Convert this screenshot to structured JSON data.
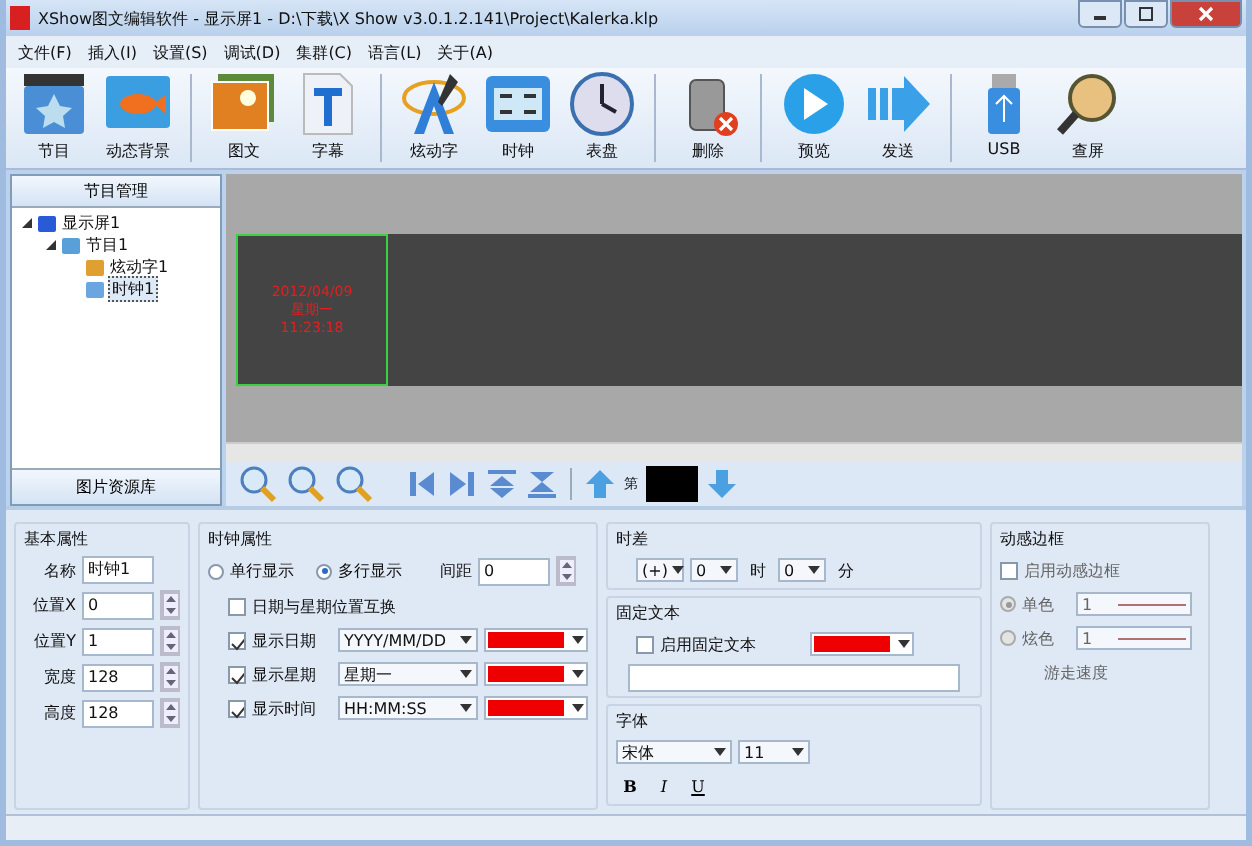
{
  "window": {
    "title": "XShow图文编辑软件 - 显示屏1 - D:\\下载\\X Show v3.0.1.2.141\\Project\\Kalerka.klp"
  },
  "menu": [
    "文件(F)",
    "插入(I)",
    "设置(S)",
    "调试(D)",
    "集群(C)",
    "语言(L)",
    "关于(A)"
  ],
  "toolbar": [
    {
      "items": [
        {
          "label": "节目"
        },
        {
          "label": "动态背景"
        }
      ]
    },
    {
      "items": [
        {
          "label": "图文"
        },
        {
          "label": "字幕"
        }
      ]
    },
    {
      "items": [
        {
          "label": "炫动字"
        },
        {
          "label": "时钟"
        },
        {
          "label": "表盘"
        }
      ]
    },
    {
      "items": [
        {
          "label": "删除"
        }
      ]
    },
    {
      "items": [
        {
          "label": "预览"
        },
        {
          "label": "发送"
        }
      ]
    },
    {
      "items": [
        {
          "label": "USB"
        },
        {
          "label": "查屏"
        }
      ]
    }
  ],
  "left_panel": {
    "header": "节目管理",
    "footer": "图片资源库",
    "tree": [
      {
        "label": "显示屏1",
        "kind": "screen",
        "selected": false,
        "expanded": true,
        "children": [
          {
            "label": "节目1",
            "kind": "program",
            "selected": false,
            "expanded": true,
            "children": [
              {
                "label": "炫动字1",
                "kind": "effect",
                "selected": false
              },
              {
                "label": "时钟1",
                "kind": "clock",
                "selected": true
              }
            ]
          }
        ]
      }
    ]
  },
  "canvas": {
    "clock_lines": [
      "2012/04/09",
      "星期一",
      "11:23:18"
    ]
  },
  "page_bar": {
    "label": "第"
  },
  "basic": {
    "title": "基本属性",
    "fields": [
      {
        "label": "名称",
        "value": "时钟1",
        "kind": "text"
      },
      {
        "label": "位置X",
        "value": "0",
        "kind": "spin"
      },
      {
        "label": "位置Y",
        "value": "1",
        "kind": "spin"
      },
      {
        "label": "宽度",
        "value": "128",
        "kind": "spin"
      },
      {
        "label": "高度",
        "value": "128",
        "kind": "spin"
      }
    ]
  },
  "clock": {
    "title": "时钟属性",
    "modes": [
      {
        "label": "单行显示",
        "selected": false
      },
      {
        "label": "多行显示",
        "selected": true
      }
    ],
    "spacing_label": "间距",
    "spacing": "0",
    "swap": {
      "label": "日期与星期位置互换",
      "checked": false
    },
    "rows": [
      {
        "label": "显示日期",
        "checked": true,
        "format": "YYYY/MM/DD",
        "color": "#ee0000"
      },
      {
        "label": "显示星期",
        "checked": true,
        "format": "星期一",
        "color": "#ee0000"
      },
      {
        "label": "显示时间",
        "checked": true,
        "format": "HH:MM:SS",
        "color": "#ee0000"
      }
    ]
  },
  "offset": {
    "title": "时差",
    "sign": "(+)",
    "hours": "0",
    "hours_unit": "时",
    "minutes": "0",
    "minutes_unit": "分"
  },
  "fixed_text": {
    "title": "固定文本",
    "enable": {
      "label": "启用固定文本",
      "checked": false
    },
    "color": "#ee0000"
  },
  "font": {
    "title": "字体",
    "family": "宋体",
    "size": "11",
    "styles": [
      "B",
      "I",
      "U"
    ]
  },
  "border": {
    "title": "动感边框",
    "enable": {
      "label": "启用动感边框",
      "checked": false
    },
    "disabled": true,
    "modes": [
      {
        "label": "单色",
        "selected": true,
        "value": "1"
      },
      {
        "label": "炫色",
        "selected": false,
        "value": "1"
      }
    ],
    "speed_label": "游走速度"
  }
}
